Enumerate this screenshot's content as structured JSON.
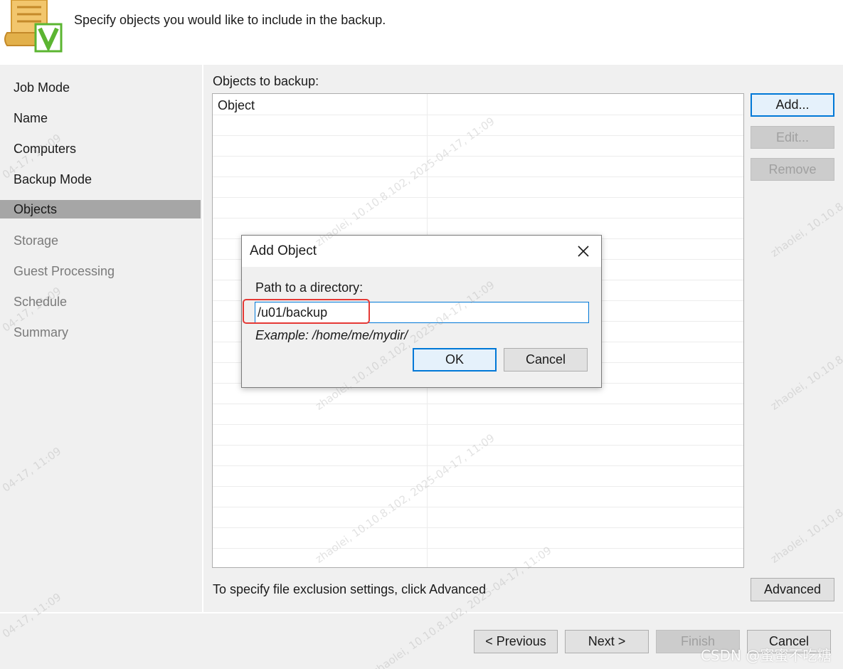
{
  "header": {
    "subtitle": "Specify objects you would like to include in the backup.",
    "icon": "scroll-checkmark-icon"
  },
  "sidebar": {
    "items": [
      {
        "label": "Job Mode",
        "state": "normal"
      },
      {
        "label": "Name",
        "state": "normal"
      },
      {
        "label": "Computers",
        "state": "normal"
      },
      {
        "label": "Backup Mode",
        "state": "normal"
      },
      {
        "label": "Objects",
        "state": "active"
      },
      {
        "label": "Storage",
        "state": "disabled"
      },
      {
        "label": "Guest Processing",
        "state": "disabled"
      },
      {
        "label": "Schedule",
        "state": "disabled"
      },
      {
        "label": "Summary",
        "state": "disabled"
      }
    ]
  },
  "main": {
    "objects_label": "Objects to backup:",
    "grid_header": "Object",
    "add_label": "Add...",
    "edit_label": "Edit...",
    "remove_label": "Remove",
    "exclusion_text": "To specify file exclusion settings, click Advanced",
    "advanced_label": "Advanced"
  },
  "footer": {
    "previous_label": "< Previous",
    "next_label": "Next >",
    "finish_label": "Finish",
    "cancel_label": "Cancel"
  },
  "dialog": {
    "title": "Add Object",
    "path_label": "Path to a directory:",
    "path_value": "/u01/backup",
    "example": "Example: /home/me/mydir/",
    "ok_label": "OK",
    "cancel_label": "Cancel"
  },
  "watermark": {
    "text_a": "zhaolei, 10.10.8.102, 2025-04-17, 11:09",
    "text_b": "04-17, 11:09",
    "csdn": "CSDN @蜜蜜不吃糖"
  },
  "colors": {
    "accent": "#0078d7",
    "highlight": "#e53935",
    "active_step": "#a6a6a6",
    "icon_green": "#5bb531",
    "icon_gold": "#e2b04a"
  }
}
